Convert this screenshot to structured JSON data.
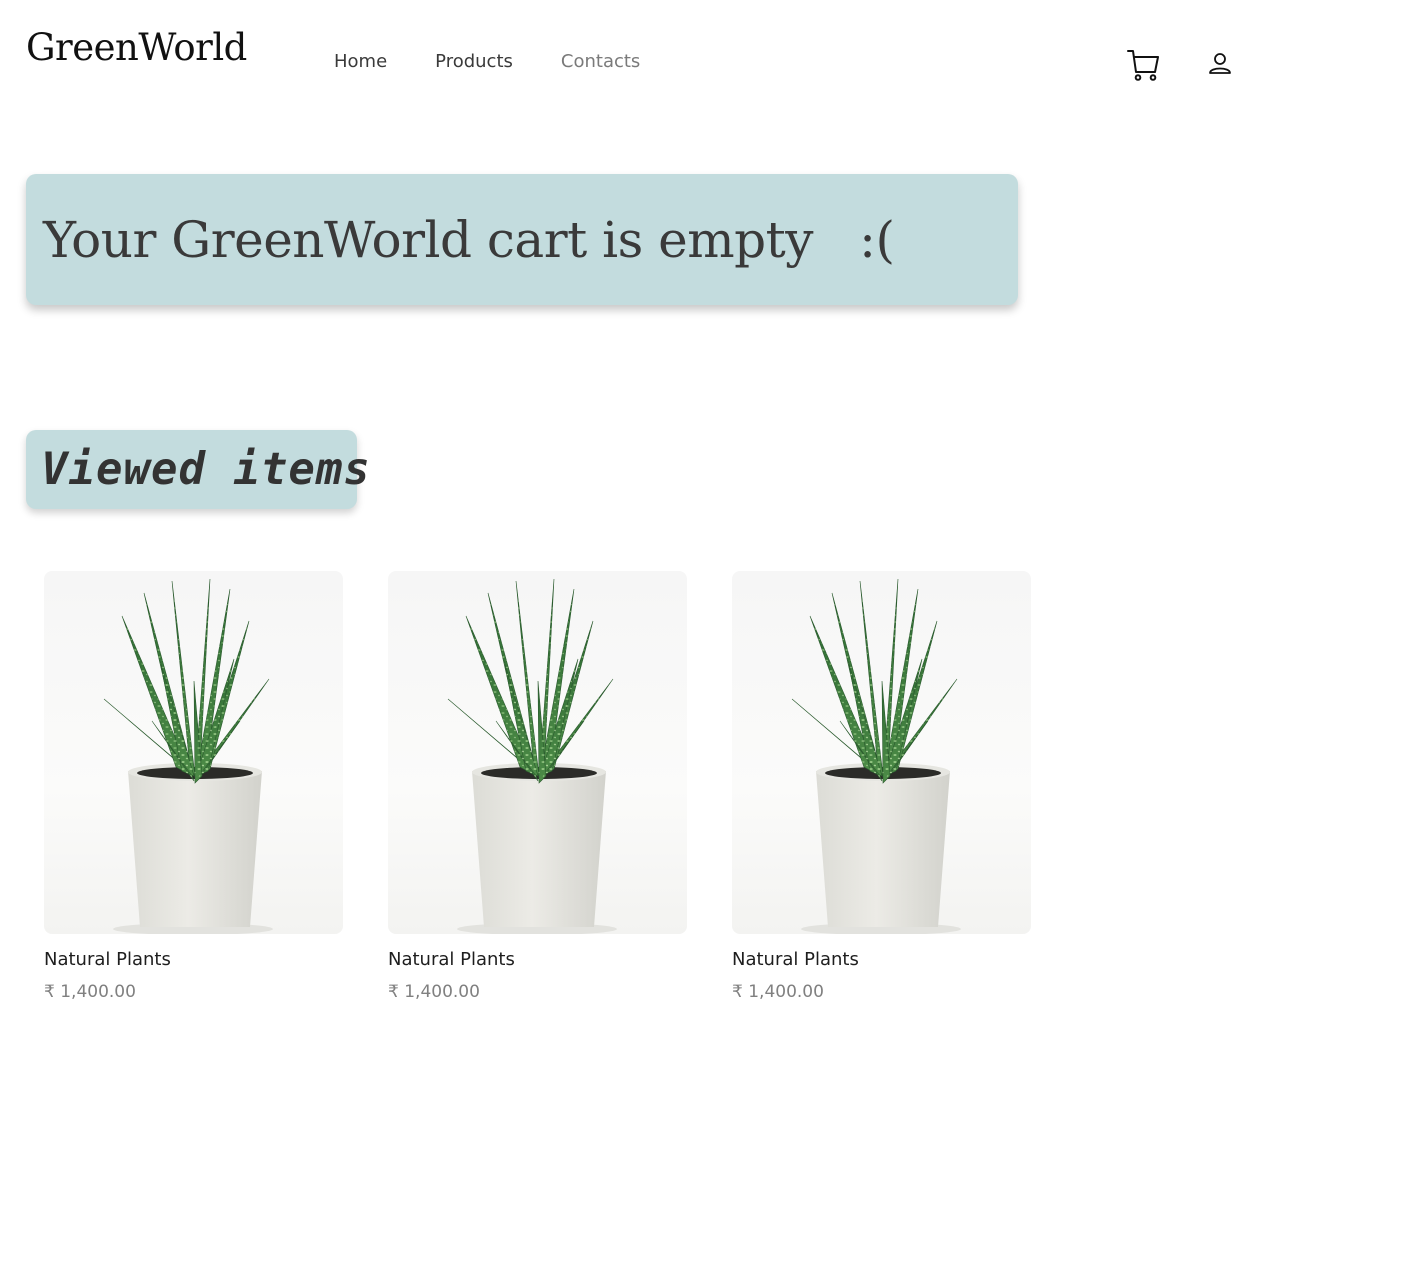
{
  "header": {
    "logo": "GreenWorld",
    "nav": [
      {
        "label": "Home"
      },
      {
        "label": "Products"
      },
      {
        "label": "Contacts"
      }
    ],
    "icons": {
      "cart": "shopping-cart-icon",
      "user": "user-icon"
    }
  },
  "cart": {
    "empty_message": "Your GreenWorld cart is empty   :("
  },
  "viewed": {
    "heading": "Viewed items",
    "products": [
      {
        "name": "Natural Plants",
        "price": "₹  1,400.00",
        "image": "potted aloe plant"
      },
      {
        "name": "Natural Plants",
        "price": "₹ 1,400.00",
        "image": "potted aloe plant"
      },
      {
        "name": "Natural Plants",
        "price": "₹ 1,400.00",
        "image": "potted aloe plant"
      }
    ]
  },
  "colors": {
    "banner_bg": "#c3dcde",
    "text_dark": "#3a3a3a",
    "price_gray": "#808080",
    "plant_green": "#3d7a3f"
  }
}
